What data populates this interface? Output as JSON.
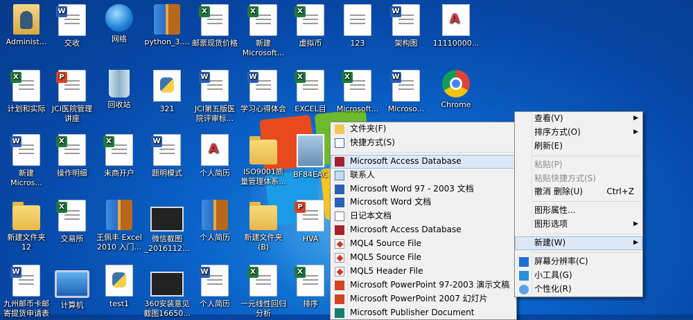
{
  "desktop": {
    "icons": [
      {
        "label": "Administ...",
        "icon": "user-folder-icon"
      },
      {
        "label": "交收",
        "icon": "word-document-icon"
      },
      {
        "label": "网络",
        "icon": "network-icon"
      },
      {
        "label": "python_3....",
        "icon": "archive-icon"
      },
      {
        "label": "邮票现货价格",
        "icon": "excel-document-icon"
      },
      {
        "label": "新建\nMicrosoft...",
        "icon": "excel-document-icon"
      },
      {
        "label": "虚拟币",
        "icon": "excel-document-icon"
      },
      {
        "label": "123",
        "icon": "blank-document-icon"
      },
      {
        "label": "架构图",
        "icon": "visio-diagram-icon"
      },
      {
        "label": "11110000...",
        "icon": "pdf-document-icon"
      },
      {
        "label": "计划和实际",
        "icon": "excel-document-icon"
      },
      {
        "label": "JCI医院管理\n讲座",
        "icon": "powerpoint-document-icon"
      },
      {
        "label": "回收站",
        "icon": "recycle-bin-icon"
      },
      {
        "label": "321",
        "icon": "python-file-icon"
      },
      {
        "label": "JCI第五版医\n院评审标...",
        "icon": "word-document-icon"
      },
      {
        "label": "学习心得体会",
        "icon": "word-document-icon"
      },
      {
        "label": "EXCEL目",
        "icon": "excel-document-icon"
      },
      {
        "label": "Microsoft...",
        "icon": "excel-document-icon"
      },
      {
        "label": "Microso...",
        "icon": "word-document-icon"
      },
      {
        "label": "Chrome",
        "icon": "chrome-icon"
      },
      {
        "label": "新建\nMicros...",
        "icon": "visio-diagram-icon"
      },
      {
        "label": "操作明细",
        "icon": "excel-document-icon"
      },
      {
        "label": "未商开户",
        "icon": "excel-document-icon"
      },
      {
        "label": "题明模式",
        "icon": "word-document-icon"
      },
      {
        "label": "个人简历",
        "icon": "pdf-document-icon"
      },
      {
        "label": "ISO9001质\n量管理体系...",
        "icon": "folder-icon"
      },
      {
        "label": "BF84EAC",
        "icon": "photo-icon"
      },
      {
        "label": "新建文件夹\n12",
        "icon": "folder-icon"
      },
      {
        "label": "交易所",
        "icon": "excel-document-icon"
      },
      {
        "label": "王佩丰 Excel\n2010 入门...",
        "icon": "archive-icon"
      },
      {
        "label": "微信截图\n_2016112...",
        "icon": "screenshot-icon"
      },
      {
        "label": "个人简历",
        "icon": "archive-icon"
      },
      {
        "label": "新建文件夹\n(B)",
        "icon": "folder-icon"
      },
      {
        "label": "HVA",
        "icon": "powerpoint-document-icon"
      },
      {
        "label": "九州邮币卡邮\n寄提货申请表",
        "icon": "word-document-icon"
      },
      {
        "label": "计算机",
        "icon": "computer-icon"
      },
      {
        "label": "test1",
        "icon": "python-file-icon"
      },
      {
        "label": "360安装意见\n截图16650...",
        "icon": "screenshot-icon"
      },
      {
        "label": "个人简历",
        "icon": "word-document-icon"
      },
      {
        "label": "一元线性回归\n分析",
        "icon": "excel-document-icon"
      },
      {
        "label": "排序",
        "icon": "excel-document-icon"
      }
    ]
  },
  "context_menu": {
    "items": [
      {
        "label": "查看(V)",
        "submenu": true
      },
      {
        "label": "排序方式(O)",
        "submenu": true
      },
      {
        "label": "刷新(E)"
      },
      {
        "sep": true
      },
      {
        "label": "粘贴(P)",
        "disabled": true
      },
      {
        "label": "粘贴快捷方式(S)",
        "disabled": true
      },
      {
        "label": "撤消 删除(U)",
        "accel": "Ctrl+Z"
      },
      {
        "sep": true
      },
      {
        "label": "图形属性..."
      },
      {
        "label": "图形选项",
        "submenu": true
      },
      {
        "sep": true
      },
      {
        "label": "新建(W)",
        "submenu": true,
        "highlight": true
      },
      {
        "sep": true
      },
      {
        "label": "屏幕分辨率(C)",
        "icon": "display-icon"
      },
      {
        "label": "小工具(G)",
        "icon": "gadgets-icon"
      },
      {
        "label": "个性化(R)",
        "icon": "personalize-icon"
      }
    ]
  },
  "new_submenu": {
    "items": [
      {
        "label": "文件夹(F)",
        "icon": "folder-icon"
      },
      {
        "label": "快捷方式(S)",
        "icon": "shortcut-icon"
      },
      {
        "sep": true
      },
      {
        "label": "Microsoft Access Database",
        "icon": "access-icon",
        "highlight": true
      },
      {
        "label": "联系人",
        "icon": "contact-icon"
      },
      {
        "label": "Microsoft Word 97 - 2003 文档",
        "icon": "word-icon"
      },
      {
        "label": "Microsoft Word 文档",
        "icon": "word-icon"
      },
      {
        "label": "日记本文档",
        "icon": "journal-icon"
      },
      {
        "label": "Microsoft Access Database",
        "icon": "access-icon"
      },
      {
        "label": "MQL4 Source File",
        "icon": "mql-icon"
      },
      {
        "label": "MQL5 Source File",
        "icon": "mql-icon"
      },
      {
        "label": "MQL5 Header File",
        "icon": "mql-icon"
      },
      {
        "label": "Microsoft PowerPoint 97-2003 演示文稿",
        "icon": "powerpoint-icon"
      },
      {
        "label": "Microsoft PowerPoint 2007 幻灯片",
        "icon": "powerpoint-icon"
      },
      {
        "label": "Microsoft Publisher Document",
        "icon": "publisher-icon"
      }
    ]
  }
}
